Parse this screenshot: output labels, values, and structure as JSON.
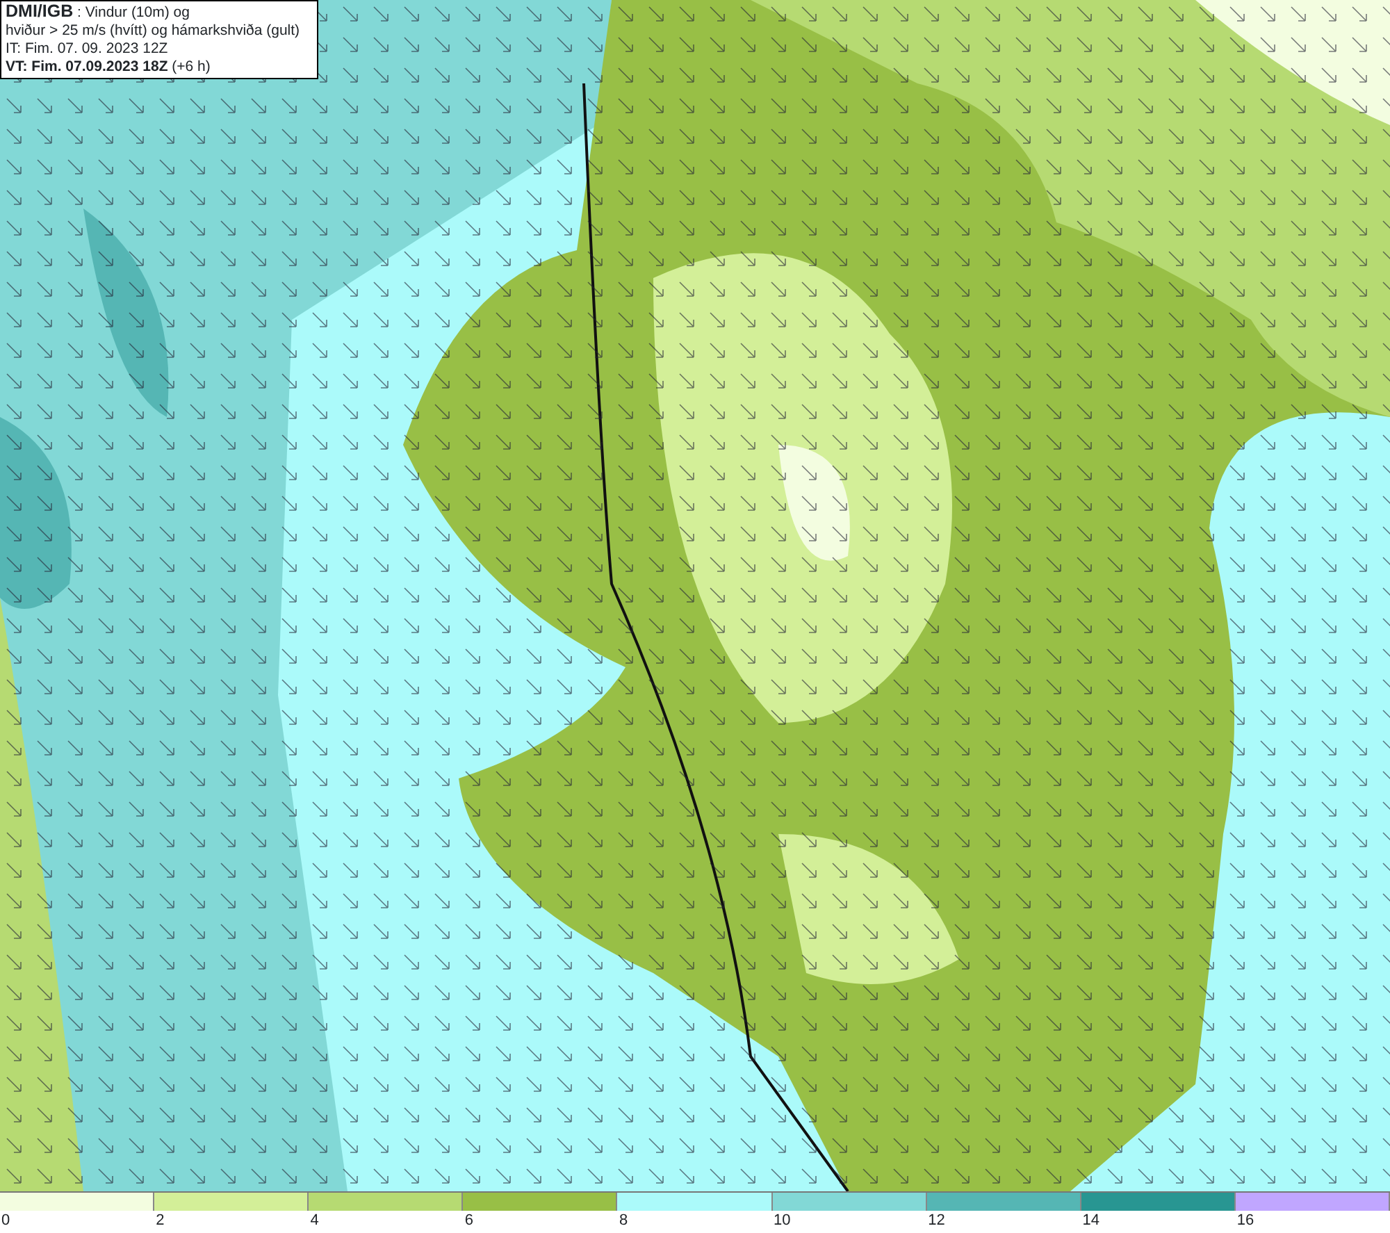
{
  "header": {
    "title": "DMI/IGB",
    "subtitle_line_1": ": Vindur (10m) og",
    "subtitle_line_2": "hviður > 25 m/s (hvítt) og hámarkshviða (gult)",
    "initial_time": "IT: Fim. 07. 09. 2023 12Z",
    "valid_time": "**VT: Fim. 07.09.2023 18Z** (+6 h)"
  },
  "colorbar": {
    "bins": [
      {
        "color": "#f3fde0"
      },
      {
        "color": "#d3ef98"
      },
      {
        "color": "#b6da72"
      },
      {
        "color": "#98bf46"
      },
      {
        "color": "#abfafa"
      },
      {
        "color": "#82d8d6"
      },
      {
        "color": "#55b6b4"
      },
      {
        "color": "#289692"
      },
      {
        "color": "#c0a6ff"
      }
    ],
    "ticks": [
      "0",
      "2",
      "4",
      "6",
      "8",
      "10",
      "12",
      "14",
      "16"
    ]
  }
}
